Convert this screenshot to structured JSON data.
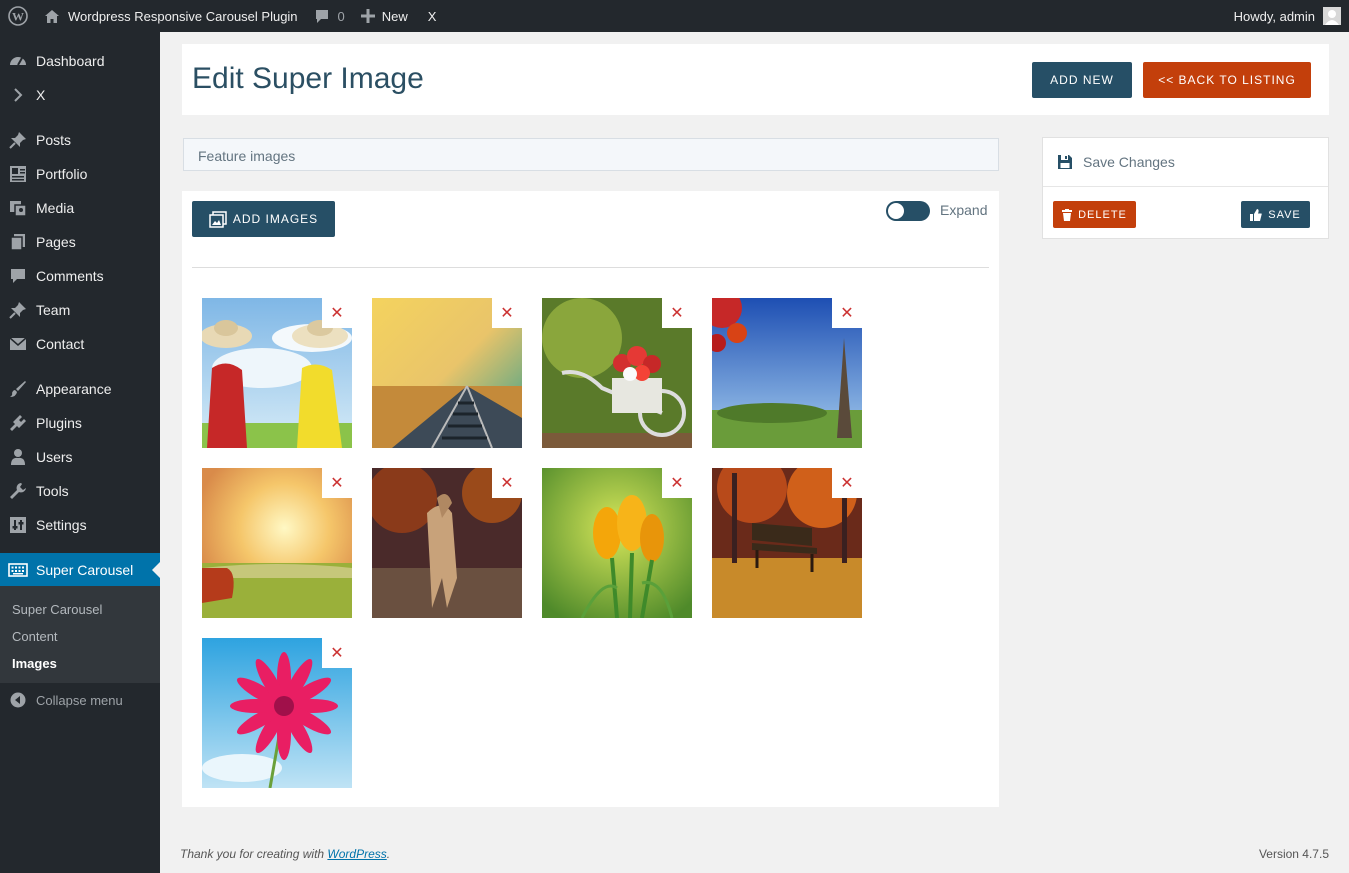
{
  "adminbar": {
    "site_name": "Wordpress Responsive Carousel Plugin",
    "comments_count": "0",
    "new_label": "New",
    "x_label": "X",
    "howdy": "Howdy, admin"
  },
  "sidebar": {
    "items": [
      {
        "label": "Dashboard",
        "icon": "dashboard-icon"
      },
      {
        "label": "X",
        "icon": "chevron-right-icon"
      },
      {
        "label": "Posts",
        "icon": "pin-icon"
      },
      {
        "label": "Portfolio",
        "icon": "portfolio-icon"
      },
      {
        "label": "Media",
        "icon": "media-icon"
      },
      {
        "label": "Pages",
        "icon": "pages-icon"
      },
      {
        "label": "Comments",
        "icon": "comment-icon"
      },
      {
        "label": "Team",
        "icon": "pin-icon"
      },
      {
        "label": "Contact",
        "icon": "mail-icon"
      },
      {
        "label": "Appearance",
        "icon": "brush-icon"
      },
      {
        "label": "Plugins",
        "icon": "plugin-icon"
      },
      {
        "label": "Users",
        "icon": "user-icon"
      },
      {
        "label": "Tools",
        "icon": "wrench-icon"
      },
      {
        "label": "Settings",
        "icon": "settings-icon"
      },
      {
        "label": "Super Carousel",
        "icon": "keyboard-icon"
      }
    ],
    "submenu": [
      "Super Carousel",
      "Content",
      "Images"
    ],
    "collapse": "Collapse menu"
  },
  "header": {
    "title": "Edit Super Image",
    "add_new": "ADD NEW",
    "back": "<< BACK TO LISTING"
  },
  "feature_bar": "Feature images",
  "main": {
    "add_images": "ADD IMAGES",
    "expand_label": "Expand",
    "remove_glyph": "✕",
    "images": [
      "women-hats",
      "railway-sunset",
      "bicycle-flowers",
      "eiffel-autumn",
      "sunset-field",
      "horse-autumn",
      "yellow-crocus",
      "park-bench-autumn",
      "pink-gerbera"
    ]
  },
  "side": {
    "title": "Save Changes",
    "delete": "DELETE",
    "save": "SAVE"
  },
  "footer": {
    "thanks_prefix": "Thank you for creating with ",
    "thanks_link": "WordPress",
    "thanks_suffix": ".",
    "version": "Version 4.7.5"
  },
  "colors": {
    "accent": "#264f66",
    "orange": "#c33f0b",
    "menu_current": "#0073aa"
  }
}
